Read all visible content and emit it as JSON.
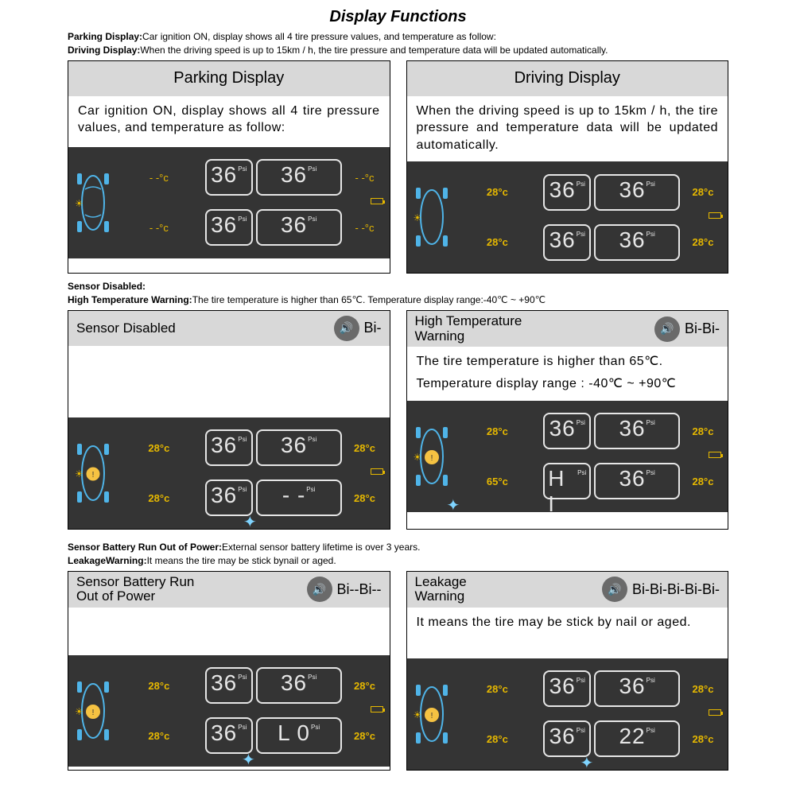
{
  "title": "Display Functions",
  "intro": {
    "line1_label": "Parking Display:",
    "line1_text": "Car ignition ON, display shows all 4 tire pressure values, and temperature as follow:",
    "line2_label": "Driving Display:",
    "line2_text": "When the driving speed is up to 15km / h, the tire pressure and temperature data will be updated automatically."
  },
  "row1": {
    "left": {
      "header": "Parking Display",
      "body": "Car ignition ON, display shows all 4 tire pressure values, and temperature as follow:",
      "lcd": {
        "fl_psi": "36",
        "fr_psi": "36",
        "rl_psi": "36",
        "rr_psi": "36",
        "fl_t": "- -°c",
        "fr_t": "- -°c",
        "rl_t": "- -°c",
        "rr_t": "- -°c"
      }
    },
    "right": {
      "header": "Driving Display",
      "body": "When the driving speed is up to 15km / h, the tire pressure and temperature data will be updated automatically.",
      "lcd": {
        "fl_psi": "36",
        "fr_psi": "36",
        "rl_psi": "36",
        "rr_psi": "36",
        "fl_t": "28°c",
        "fr_t": "28°c",
        "rl_t": "28°c",
        "rr_t": "28°c"
      }
    }
  },
  "mid_intro": {
    "line1_label": "Sensor Disabled:",
    "line2_label": "High Temperature Warning:",
    "line2_text": "The tire temperature is higher than 65℃. Temperature display range:-40℃ ~ +90℃"
  },
  "row2": {
    "left": {
      "header": "Sensor Disabled",
      "sound": "Bi-",
      "lcd": {
        "fl_psi": "36",
        "fr_psi": "36",
        "rl_psi": "36",
        "rr_psi": "- -",
        "fl_t": "28°c",
        "fr_t": "28°c",
        "rl_t": "28°c",
        "rr_t": "28°c"
      }
    },
    "right": {
      "header": "High Temperature Warning",
      "sound": "Bi-Bi-",
      "body": "The tire temperature is higher than 65℃.",
      "body2": "Temperature display range : -40℃ ~ +90℃",
      "lcd": {
        "fl_psi": "36",
        "fr_psi": "36",
        "rl_psi": "H I",
        "rr_psi": "36",
        "fl_t": "28°c",
        "fr_t": "28°c",
        "rl_t": "65°c",
        "rr_t": "28°c"
      }
    }
  },
  "bot_intro": {
    "line1_label": "Sensor Battery Run Out of Power:",
    "line1_text": "External sensor battery lifetime is over 3 years.",
    "line2_label": "LeakageWarning:",
    "line2_text": "It means the tire may be stick bynail or aged."
  },
  "row3": {
    "left": {
      "header": "Sensor Battery Run Out of Power",
      "sound": "Bi--Bi--",
      "lcd": {
        "fl_psi": "36",
        "fr_psi": "36",
        "rl_psi": "36",
        "rr_psi": "L 0",
        "fl_t": "28°c",
        "fr_t": "28°c",
        "rl_t": "28°c",
        "rr_t": "28°c"
      }
    },
    "right": {
      "header": "Leakage Warning",
      "sound": "Bi-Bi-Bi-Bi-Bi-",
      "body": "It means the tire may be stick by nail or aged.",
      "lcd": {
        "fl_psi": "36",
        "fr_psi": "36",
        "rl_psi": "36",
        "rr_psi": "22",
        "fl_t": "28°c",
        "fr_t": "28°c",
        "rl_t": "28°c",
        "rr_t": "28°c"
      }
    }
  },
  "psi_unit": "Psi"
}
